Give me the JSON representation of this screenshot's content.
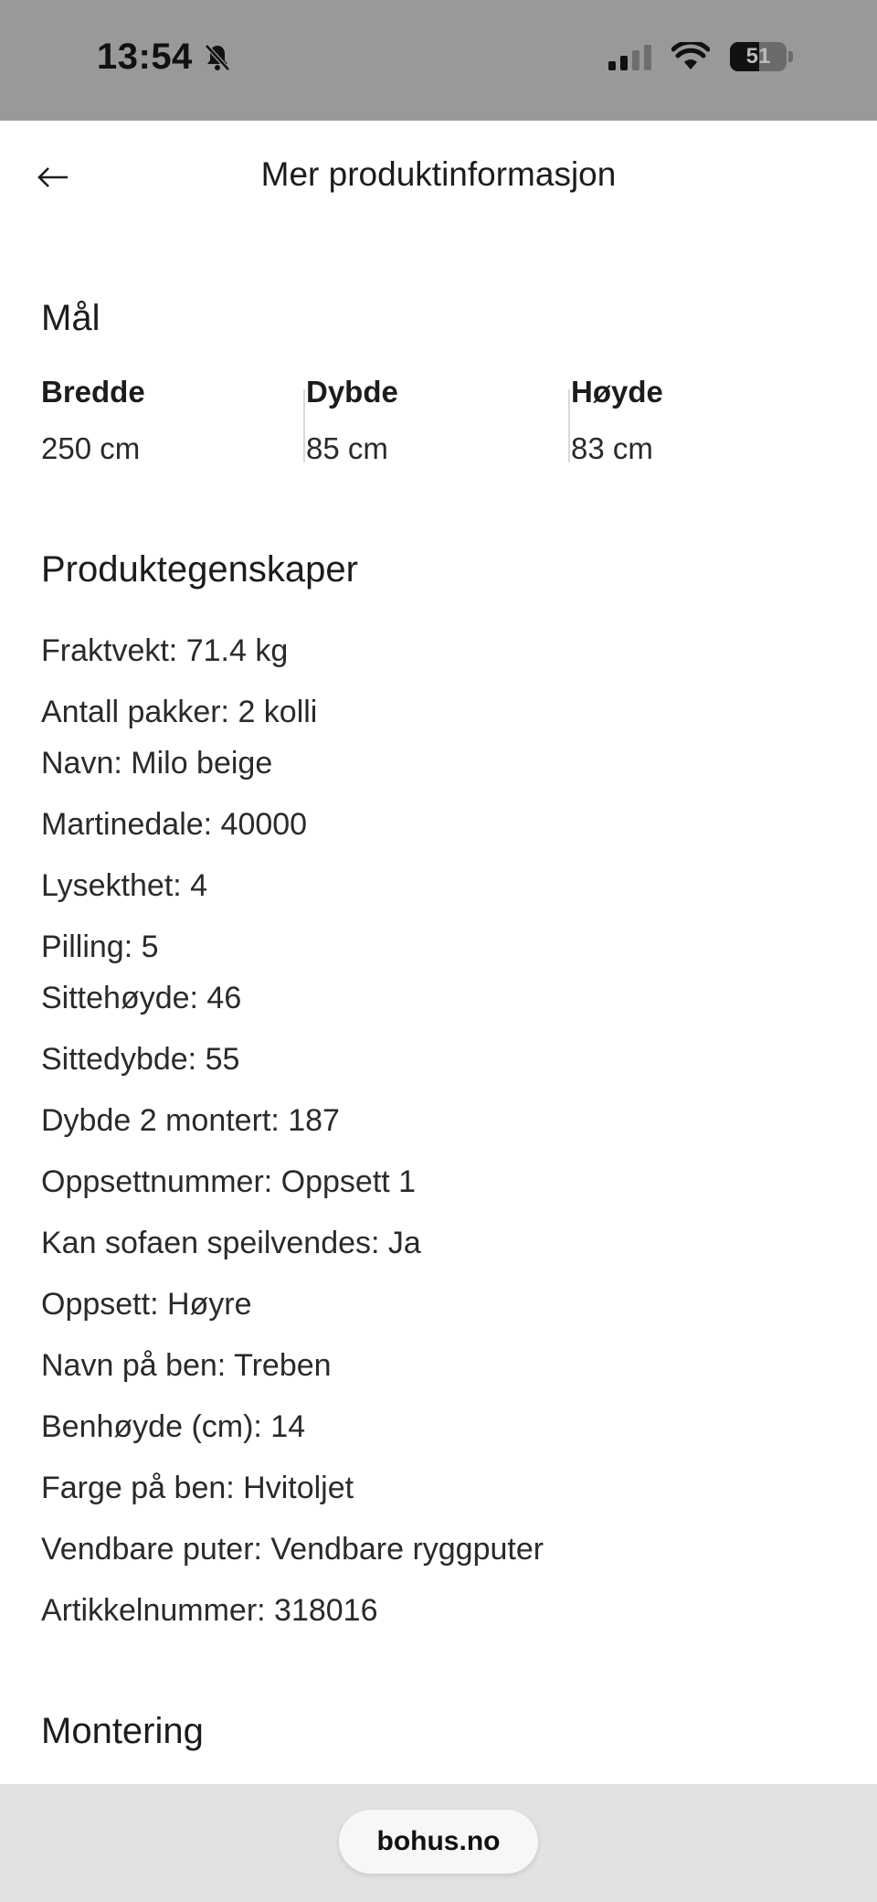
{
  "status_bar": {
    "time": "13:54",
    "battery_level": "51",
    "battery_fraction": 0.51,
    "icons": [
      "bell-slash-icon",
      "cellular-signal-icon",
      "wifi-icon",
      "battery-icon"
    ]
  },
  "header": {
    "title": "Mer produktinformasjon",
    "back_icon": "arrow-left-icon"
  },
  "dimensions": {
    "title": "Mål",
    "items": [
      {
        "label": "Bredde",
        "value": "250 cm"
      },
      {
        "label": "Dybde",
        "value": "85 cm"
      },
      {
        "label": "Høyde",
        "value": "83 cm"
      }
    ]
  },
  "properties": {
    "title": "Produktegenskaper",
    "items": [
      "Fraktvekt: 71.4 kg",
      "Antall pakker: 2 kolli",
      "Navn: Milo beige",
      "Martinedale: 40000",
      "Lysekthet: 4",
      "Pilling: 5",
      "Sittehøyde: 46",
      "Sittedybde: 55",
      "Dybde 2 montert: 187",
      "Oppsettnummer: Oppsett 1",
      "Kan sofaen speilvendes: Ja",
      "Oppsett: Høyre",
      "Navn på ben: Treben",
      "Benhøyde (cm): 14",
      "Farge på ben: Hvitoljet",
      "Vendbare puter: Vendbare ryggputer",
      "Artikkelnummer: 318016"
    ]
  },
  "assembly": {
    "title": "Montering"
  },
  "browser": {
    "url": "bohus.no"
  },
  "colors": {
    "status_bar_bg": "#999999",
    "browser_bar_bg": "#e2e2e2",
    "text": "#1c1c1c"
  }
}
